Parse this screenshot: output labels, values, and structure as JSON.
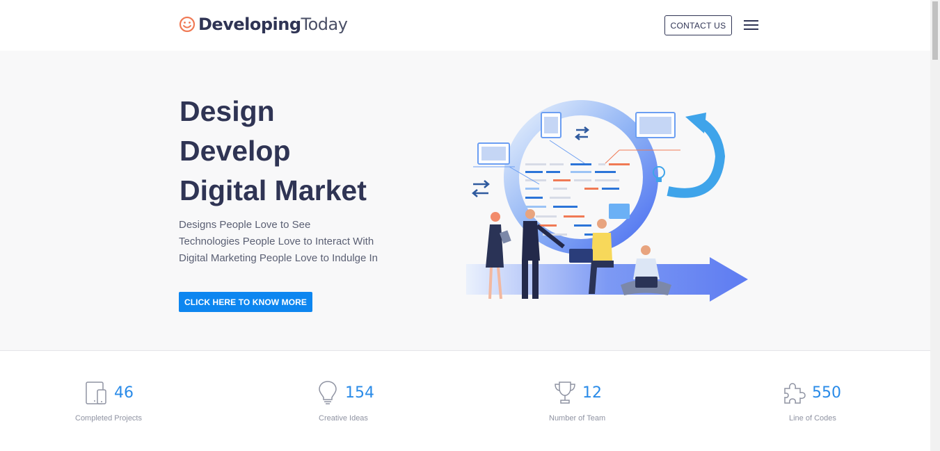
{
  "header": {
    "logo_bold": "Developing",
    "logo_light": "Today",
    "contact_label": "CONTACT US"
  },
  "hero": {
    "title_lines": [
      "Design",
      "Develop",
      "Digital Market"
    ],
    "subtitle_lines": [
      "Designs People Love to See",
      "Technologies People Love to Interact With",
      "Digital Marketing People Love to Indulge In"
    ],
    "cta_label": "CLICK HERE TO KNOW MORE"
  },
  "stats": [
    {
      "icon": "devices-icon",
      "number": "46",
      "label": "Completed Projects"
    },
    {
      "icon": "lightbulb-icon",
      "number": "154",
      "label": "Creative Ideas"
    },
    {
      "icon": "trophy-icon",
      "number": "12",
      "label": "Number of Team"
    },
    {
      "icon": "puzzle-icon",
      "number": "550",
      "label": "Line of Codes"
    }
  ],
  "colors": {
    "brand_dark": "#2f3454",
    "accent_blue": "#0d86f0",
    "stat_blue": "#2a8be8",
    "logo_orange": "#f07a55",
    "hero_bg": "#f8f8f9"
  }
}
